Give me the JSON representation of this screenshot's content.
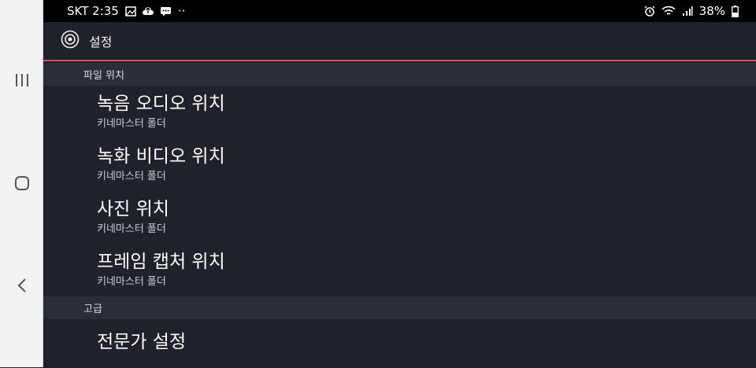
{
  "status_bar": {
    "carrier_time": "SKT 2:35",
    "dots": "··",
    "battery": "38%",
    "icons_left": [
      "image-icon",
      "cloud-upload-icon",
      "message-icon"
    ],
    "icons_right": [
      "alarm-icon",
      "wifi-icon",
      "signal-icon",
      "battery-icon"
    ]
  },
  "toolbar": {
    "icon": "settings-icon",
    "title": "설정"
  },
  "sections": [
    {
      "header": "파일 위치",
      "items": [
        {
          "title": "녹음 오디오 위치",
          "subtitle": "키네마스터 폴더"
        },
        {
          "title": "녹화 비디오 위치",
          "subtitle": "키네마스터 폴더"
        },
        {
          "title": "사진 위치",
          "subtitle": "키네마스터 폴더"
        },
        {
          "title": "프레임 캡처 위치",
          "subtitle": "키네마스터 폴더"
        }
      ]
    },
    {
      "header": "고급",
      "items": [
        {
          "title": "전문가 설정"
        }
      ]
    }
  ],
  "nav": {
    "buttons": [
      "recent-apps-icon",
      "home-icon",
      "back-icon"
    ]
  },
  "colors": {
    "background": "#1f222a",
    "section_header": "#2a2e37",
    "accent": "#d9534f",
    "nav_bar": "#f3f3f3"
  }
}
